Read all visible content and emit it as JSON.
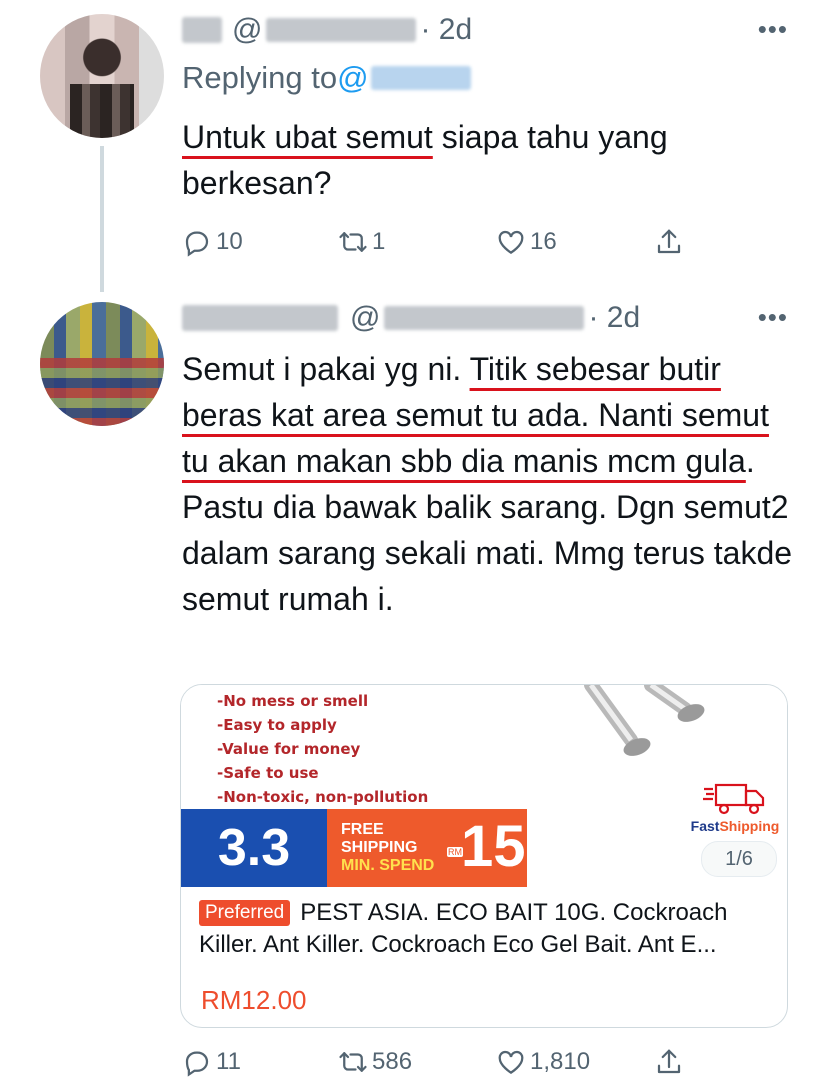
{
  "tweet1": {
    "username_blurred": "██",
    "handle_prefix": "@",
    "handle_blurred": "██████",
    "time": "· 2d",
    "more": "•••",
    "replying_prefix": "Replying to ",
    "replying_at": "@",
    "text_underlined": "Untuk ubat semut",
    "text_rest": " siapa tahu yang berkesan?",
    "stats": {
      "replies": "10",
      "retweets": "1",
      "likes": "16"
    }
  },
  "tweet2": {
    "handle_prefix": "@",
    "time": "· 2d",
    "more": "•••",
    "text_plain1": "Semut i pakai yg ni. ",
    "text_underlined": "Titik sebesar butir beras kat area semut tu ada. Nanti semut tu akan makan sbb dia manis mcm gula",
    "text_plain2": ". Pastu dia bawak balik sarang. Dgn semut2 dalam sarang sekali mati. Mmg terus takde semut rumah i.",
    "stats": {
      "replies": "11",
      "retweets": "586",
      "likes": "1,810"
    }
  },
  "card": {
    "features": [
      "-No mess or smell",
      "-Easy to apply",
      "-Value for money",
      "-Safe to use",
      "-Non-toxic, non-pollution"
    ],
    "banner_left": "3.3",
    "banner_free": "FREE",
    "banner_shipping": "SHIPPING",
    "banner_min": "MIN. SPEND",
    "banner_rm": "RM",
    "banner_amount": "15",
    "fast_a": "Fast",
    "fast_b": "Shipping",
    "pager": "1/6",
    "badge": "Preferred",
    "title": "PEST ASIA. ECO BAIT 10G. Cockroach Killer. Ant Killer. Cockroach Eco Gel Bait. Ant E...",
    "price": "RM12.00"
  },
  "colors": {
    "underline": "#d9121c",
    "link": "#1d9bf0",
    "secondary_text": "#536471",
    "price": "#ee4d2d",
    "banner_blue": "#1a4fb0",
    "banner_orange": "#ee5a2c"
  },
  "icons": [
    "reply-icon",
    "retweet-icon",
    "like-icon",
    "share-icon",
    "more-icon",
    "truck-icon"
  ]
}
